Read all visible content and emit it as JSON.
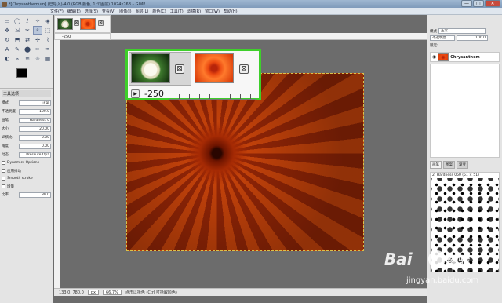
{
  "window": {
    "title": "*[Chrysanthemum] (已导入)-4.0 (RGB 颜色, 1 个图层) 1024x768 – GIMP",
    "min": "—",
    "max": "□",
    "close": "✕"
  },
  "menu": [
    "文件(F)",
    "编辑(E)",
    "选择(S)",
    "查看(V)",
    "图像(I)",
    "图层(L)",
    "颜色(C)",
    "工具(T)",
    "滤镜(R)",
    "窗口(W)",
    "帮助(H)"
  ],
  "toolbox": {
    "tools": [
      "▭",
      "◯",
      "ℓ",
      "✧",
      "◈",
      "✥",
      "⇲",
      "✂",
      "⌕",
      "⬚",
      "↻",
      "⬒",
      "⇄",
      "✢",
      "⌇",
      "A",
      "✎",
      "⬤",
      "✏",
      "✒",
      "◐",
      "⌁",
      "≋",
      "☼",
      "▦"
    ],
    "selected_tool_index": 8,
    "options_title": "工具选项",
    "mode_label": "模式",
    "mode_value": "正常",
    "opacity_label": "不透明度",
    "opacity_value": "100.0",
    "brush_label": "画笔",
    "brush_value": "Hardness 0",
    "size_label": "大小",
    "size_value": "20.00",
    "aspect_label": "纵横比",
    "aspect_value": "0.00",
    "angle_label": "角度",
    "angle_value": "0.00",
    "dynamics_label": "动态",
    "dynamics_value": "Pressure Opa",
    "dynamics_options": "Dynamics Options",
    "jitter": "应用抖动",
    "smooth": "Smooth stroke",
    "incremental": "增量",
    "rate_label": "比率",
    "rate_value": "80.0"
  },
  "tabs": {
    "ruler_value": "-250",
    "close_icon": "⊠"
  },
  "callout": {
    "ruler_value": "-250",
    "close_icon": "⊠",
    "play_icon": "▶"
  },
  "dock": {
    "mode_label": "模式",
    "mode_value": "正常",
    "opacity_label": "不透明度",
    "opacity_value": "100.0",
    "lock_label": "锁定:",
    "layer_name": "Chrysanthem",
    "eye_icon": "◉",
    "brush_tabs": [
      "画笔",
      "图案",
      "渐变"
    ],
    "brush_caption": "2. Hardness 050 (51 × 51)"
  },
  "status": {
    "coords": "133.0, 780.0",
    "unit": "px",
    "zoom": "66.7%",
    "message": "点击以拾色 (Ctrl 可拾取颜色)"
  },
  "watermark": {
    "brand": "Bai",
    "cn": "经验",
    "url": "jingyan.baidu.com"
  },
  "colors": {
    "highlight": "#3ecf2a",
    "foreground": "#000000",
    "background": "#ffffff"
  }
}
